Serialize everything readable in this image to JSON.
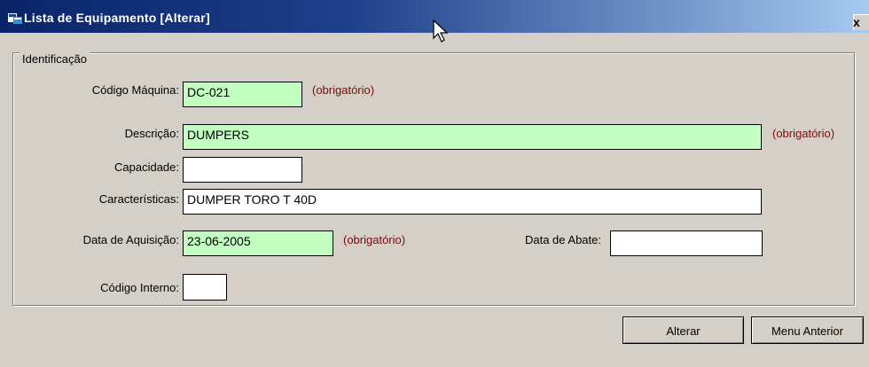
{
  "window": {
    "title": "Lista de Equipamento [Alterar]",
    "close_glyph": "x"
  },
  "group": {
    "legend": "Identificação"
  },
  "form": {
    "codigo_maquina": {
      "label": "Código Máquina:",
      "value": "DC-021",
      "required": "(obrigatório)"
    },
    "descricao": {
      "label": "Descrição:",
      "value": "DUMPERS",
      "required": "(obrigatório)"
    },
    "capacidade": {
      "label": "Capacidade:",
      "value": ""
    },
    "caracteristicas": {
      "label": "Características:",
      "value": "DUMPER TORO T 40D"
    },
    "data_aquisicao": {
      "label": "Data de Aquisição:",
      "value": "23-06-2005",
      "required": "(obrigatório)"
    },
    "data_abate": {
      "label": "Data de Abate:",
      "value": ""
    },
    "codigo_interno": {
      "label": "Código Interno:",
      "value": ""
    }
  },
  "buttons": {
    "alterar": "Alterar",
    "menu_anterior": "Menu Anterior"
  },
  "colors": {
    "title_start": "#0a246a",
    "title_end": "#a6caf0",
    "required_field_bg": "#c0ffc0",
    "required_text": "#7a0b0b",
    "window_bg": "#d4d0c8"
  }
}
